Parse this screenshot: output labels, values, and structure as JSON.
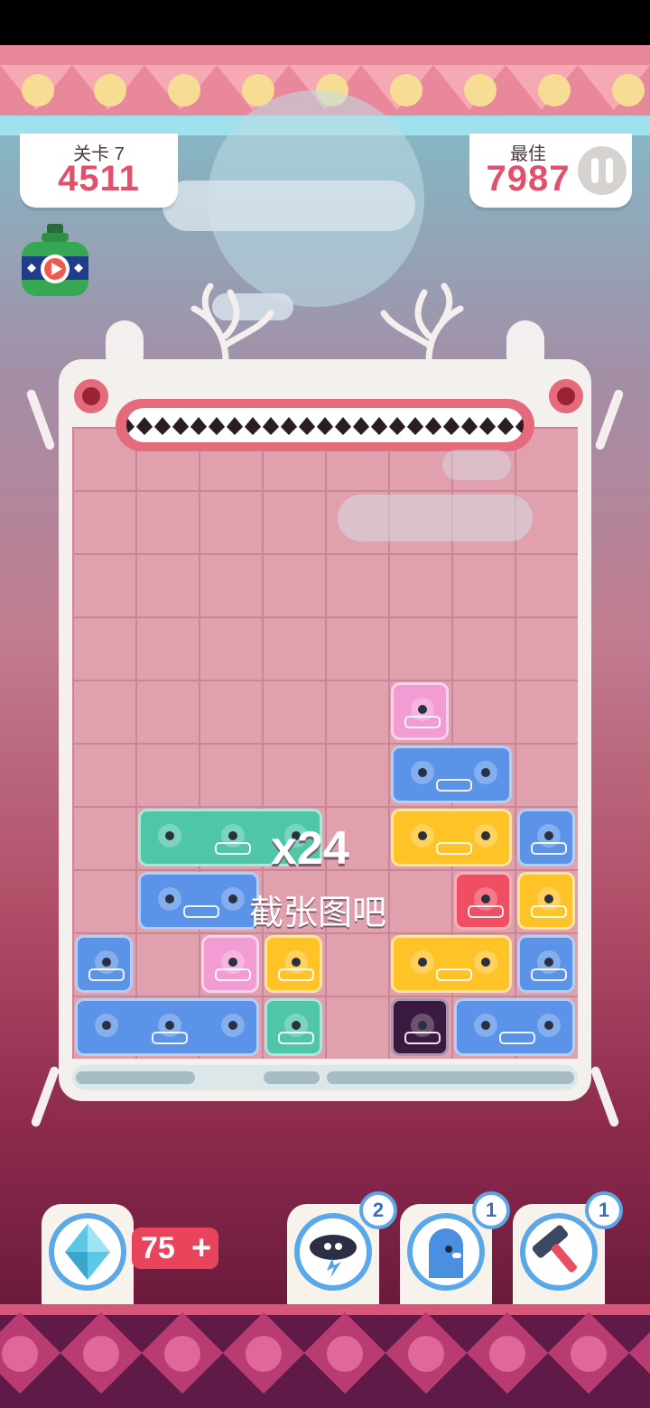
{
  "header": {
    "level_label": "关卡 7",
    "score": "4511",
    "best_label": "最佳",
    "best_score": "7987"
  },
  "board": {
    "combo": "x24",
    "combo_message": "截张图吧",
    "rows": 10,
    "columns": 8,
    "blocks": [
      {
        "color": "pink",
        "row": 5,
        "col": 6,
        "width": 1
      },
      {
        "color": "blue",
        "row": 6,
        "col": 6,
        "width": 2
      },
      {
        "color": "green",
        "row": 7,
        "col": 2,
        "width": 3
      },
      {
        "color": "yellow",
        "row": 7,
        "col": 6,
        "width": 2
      },
      {
        "color": "blue",
        "row": 7,
        "col": 8,
        "width": 1
      },
      {
        "color": "blue",
        "row": 8,
        "col": 2,
        "width": 2
      },
      {
        "color": "red",
        "row": 8,
        "col": 7,
        "width": 1
      },
      {
        "color": "yellow",
        "row": 8,
        "col": 8,
        "width": 1
      },
      {
        "color": "blue",
        "row": 9,
        "col": 1,
        "width": 1
      },
      {
        "color": "pink",
        "row": 9,
        "col": 3,
        "width": 1
      },
      {
        "color": "yellow",
        "row": 9,
        "col": 4,
        "width": 1
      },
      {
        "color": "yellow",
        "row": 9,
        "col": 6,
        "width": 2
      },
      {
        "color": "blue",
        "row": 9,
        "col": 8,
        "width": 1
      },
      {
        "color": "blue",
        "row": 10,
        "col": 1,
        "width": 3
      },
      {
        "color": "green",
        "row": 10,
        "col": 4,
        "width": 1
      },
      {
        "color": "dark",
        "row": 10,
        "col": 6,
        "width": 1
      },
      {
        "color": "blue",
        "row": 10,
        "col": 7,
        "width": 2
      }
    ]
  },
  "shop": {
    "gem_count": "75",
    "gem_plus": "+"
  },
  "powerups": [
    {
      "name": "storm-cloud-icon",
      "count": "2"
    },
    {
      "name": "ghost-icon",
      "count": "1"
    },
    {
      "name": "hammer-icon",
      "count": "1"
    }
  ],
  "colors": {
    "pink": "#f29cd3",
    "blue": "#5b93e8",
    "green": "#4fc6a8",
    "yellow": "#ffc327",
    "red": "#f04e62",
    "dark": "#3a1a40",
    "score_red": "#e2516b"
  }
}
